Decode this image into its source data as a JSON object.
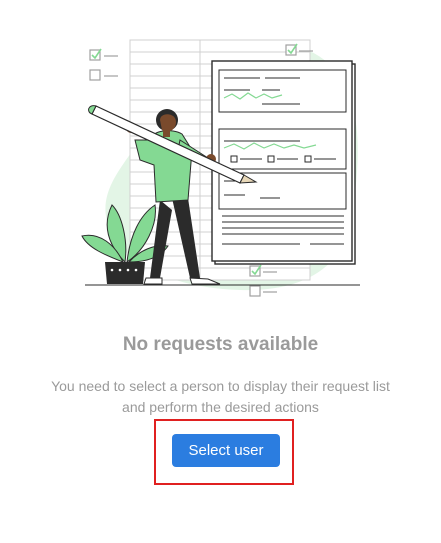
{
  "empty_state": {
    "title": "No requests available",
    "description_line1": "You need to select a person to display their request list",
    "description_line2": "and perform the desired actions",
    "button_label": "Select user"
  },
  "illustration": {
    "icon": "document-review-illustration"
  },
  "colors": {
    "accent": "#2b7de0",
    "text_muted": "#9a9a9a",
    "highlight": "#e02020",
    "illustration_green": "#84d993",
    "illustration_green_light": "#e3f5e6"
  }
}
